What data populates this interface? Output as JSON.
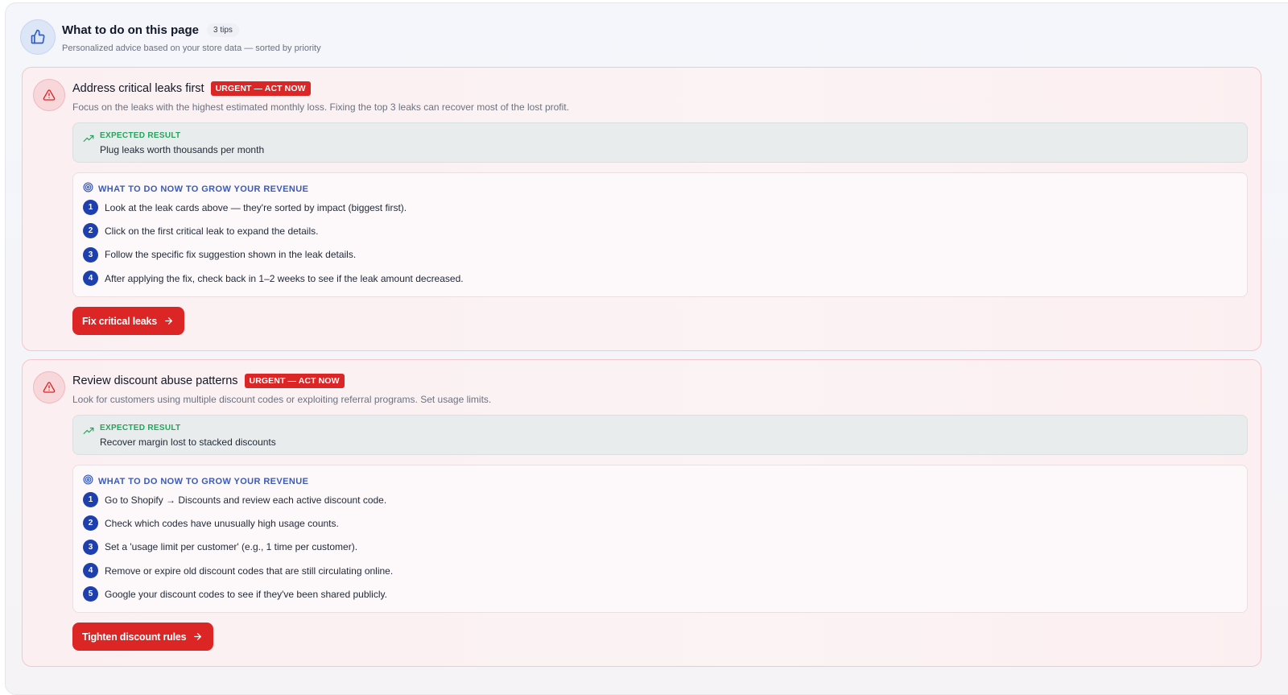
{
  "header": {
    "title": "What to do on this page",
    "tips_count": "3 tips",
    "subtitle": "Personalized advice based on your store data — sorted by priority",
    "icon": "thumbs-up-icon"
  },
  "colors": {
    "urgent": "#dc2626",
    "step_number": "#1e40af",
    "expected_label": "#22a55b",
    "steps_label": "#3b5bb5"
  },
  "tips": [
    {
      "title": "Address critical leaks first",
      "badge": "URGENT — ACT NOW",
      "description": "Focus on the leaks with the highest estimated monthly loss. Fixing the top 3 leaks can recover most of the lost profit.",
      "expected_label": "EXPECTED RESULT",
      "expected_value": "Plug leaks worth thousands per month",
      "steps_label": "WHAT TO DO NOW TO GROW YOUR REVENUE",
      "steps": [
        {
          "num": "1",
          "text": "Look at the leak cards above — they're sorted by impact (biggest first)."
        },
        {
          "num": "2",
          "text": "Click on the first critical leak to expand the details."
        },
        {
          "num": "3",
          "text": "Follow the specific fix suggestion shown in the leak details."
        },
        {
          "num": "4",
          "text": "After applying the fix, check back in 1–2 weeks to see if the leak amount decreased."
        }
      ],
      "button": "Fix critical leaks"
    },
    {
      "title": "Review discount abuse patterns",
      "badge": "URGENT — ACT NOW",
      "description": "Look for customers using multiple discount codes or exploiting referral programs. Set usage limits.",
      "expected_label": "EXPECTED RESULT",
      "expected_value": "Recover margin lost to stacked discounts",
      "steps_label": "WHAT TO DO NOW TO GROW YOUR REVENUE",
      "steps": [
        {
          "num": "1",
          "text": "Go to Shopify → Discounts and review each active discount code."
        },
        {
          "num": "2",
          "text": "Check which codes have unusually high usage counts."
        },
        {
          "num": "3",
          "text": "Set a 'usage limit per customer' (e.g., 1 time per customer)."
        },
        {
          "num": "4",
          "text": "Remove or expire old discount codes that are still circulating online."
        },
        {
          "num": "5",
          "text": "Google your discount codes to see if they've been shared publicly."
        }
      ],
      "button": "Tighten discount rules"
    }
  ]
}
